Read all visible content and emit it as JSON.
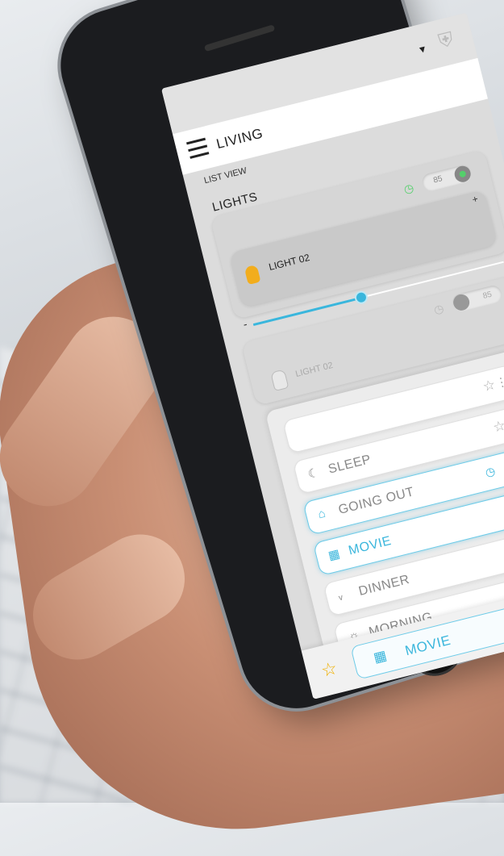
{
  "header": {
    "room": "LIVING",
    "view_label": "LIST VIEW"
  },
  "status": {
    "dropdown_icon": "caret-down-icon",
    "badge_icon": "shield-icon"
  },
  "lights": {
    "section_title": "LIGHTS",
    "items": [
      {
        "name": "LIGHT 02",
        "level": "85",
        "state": "on",
        "brightness_percent": 42,
        "timer": true
      },
      {
        "name": "LIGHT 02",
        "level": "85",
        "state": "off",
        "timer": true
      }
    ]
  },
  "scenes": {
    "items": [
      {
        "label": "",
        "icon": "blank",
        "favorite": false
      },
      {
        "label": "SLEEP",
        "icon": "moon-icon",
        "favorite": false
      },
      {
        "label": "GOING OUT",
        "icon": "leave-home-icon",
        "favorite": true,
        "scheduled": true
      },
      {
        "label": "MOVIE",
        "icon": "film-icon",
        "favorite": false,
        "active": true
      },
      {
        "label": "DINNER",
        "icon": "cutlery-icon",
        "favorite": false
      },
      {
        "label": "MORNING",
        "icon": "sun-icon",
        "favorite": false
      }
    ]
  },
  "bottom": {
    "current_scene": "MOVIE"
  },
  "colors": {
    "accent": "#3ab6dc",
    "favorite": "#f0b000",
    "on": "#54d06b"
  }
}
